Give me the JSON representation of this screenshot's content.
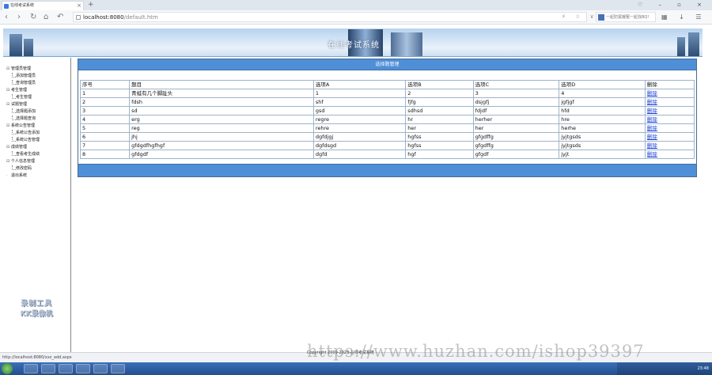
{
  "browser": {
    "tab_title": "在线考试系统",
    "tab_close": "×",
    "new_tab": "+",
    "window_controls": "♡ – ▫ ×",
    "nav": {
      "back": "‹",
      "forward": "›",
      "reload": "↻",
      "home": "⌂",
      "undo": "↶"
    },
    "url_host": "localhost:8080",
    "url_path": "/default.htm",
    "toolbar_icons": "⚡ ☆ ∨",
    "search_text": "一起防窦娥冤一起找BQ!",
    "right_icons": "▦ ↓ ☰"
  },
  "banner": {
    "title": "在线考试系统"
  },
  "sidebar": {
    "tree": [
      {
        "label": "管理员管理",
        "level": 0,
        "toggle": "⊟"
      },
      {
        "label": "添加管理员",
        "level": 1
      },
      {
        "label": "查询管理员",
        "level": 1
      },
      {
        "label": "考生管理",
        "level": 0,
        "toggle": "⊟"
      },
      {
        "label": "考生管理",
        "level": 1
      },
      {
        "label": "试题管理",
        "level": 0,
        "toggle": "⊟"
      },
      {
        "label": "选择题添加",
        "level": 1
      },
      {
        "label": "选择题查询",
        "level": 1
      },
      {
        "label": "系统公告管理",
        "level": 0,
        "toggle": "⊟"
      },
      {
        "label": "系统公告添加",
        "level": 1
      },
      {
        "label": "系统公告管理",
        "level": 1
      },
      {
        "label": "成绩管理",
        "level": 0,
        "toggle": "⊟"
      },
      {
        "label": "查看考生成绩",
        "level": 1
      },
      {
        "label": "个人信息管理",
        "level": 0,
        "toggle": "⊟"
      },
      {
        "label": "修改密码",
        "level": 1
      },
      {
        "label": "退出系统",
        "level": 0,
        "toggle": "·"
      }
    ],
    "logo_line1": "录制工具",
    "logo_line2": "KK录像机"
  },
  "panel": {
    "title": "选择题管理",
    "columns": [
      "序号",
      "题目",
      "选项A",
      "选项B",
      "选项C",
      "选项D",
      "删除"
    ],
    "rows": [
      [
        "1",
        "青蛙有几个脚趾头",
        "1",
        "2",
        "3",
        "4",
        "删除"
      ],
      [
        "2",
        "fdsh",
        "shf",
        "fjfg",
        "dsjgfj",
        "jgfjgf",
        "删除"
      ],
      [
        "3",
        "sd",
        "gsd",
        "sdhsd",
        "fdjdf",
        "hfd",
        "删除"
      ],
      [
        "4",
        "erg",
        "regre",
        "hr",
        "herher",
        "hre",
        "删除"
      ],
      [
        "5",
        "reg",
        "rehre",
        "her",
        "her",
        "herhe",
        "删除"
      ],
      [
        "6",
        "jhj",
        "dgfdjgj",
        "hgfss",
        "gfgdffg",
        "jyjtgsds",
        "删除"
      ],
      [
        "7",
        "gfdgdfhgfhgf",
        "dgfdsgd",
        "hgfss",
        "gfgdffg",
        "jyjtgsds",
        "删除"
      ],
      [
        "8",
        "gfdgdf",
        "dgfd",
        "hgf",
        "gfgdf",
        "jyjt",
        "删除"
      ]
    ]
  },
  "status": {
    "link": "http://localhost:8080/xxz_add.aspx",
    "copyright": "Copyright 2009-2023 在线考试系统"
  },
  "taskbar": {
    "clock": "23:48"
  },
  "watermark": "https://www.huzhan.com/ishop39397"
}
